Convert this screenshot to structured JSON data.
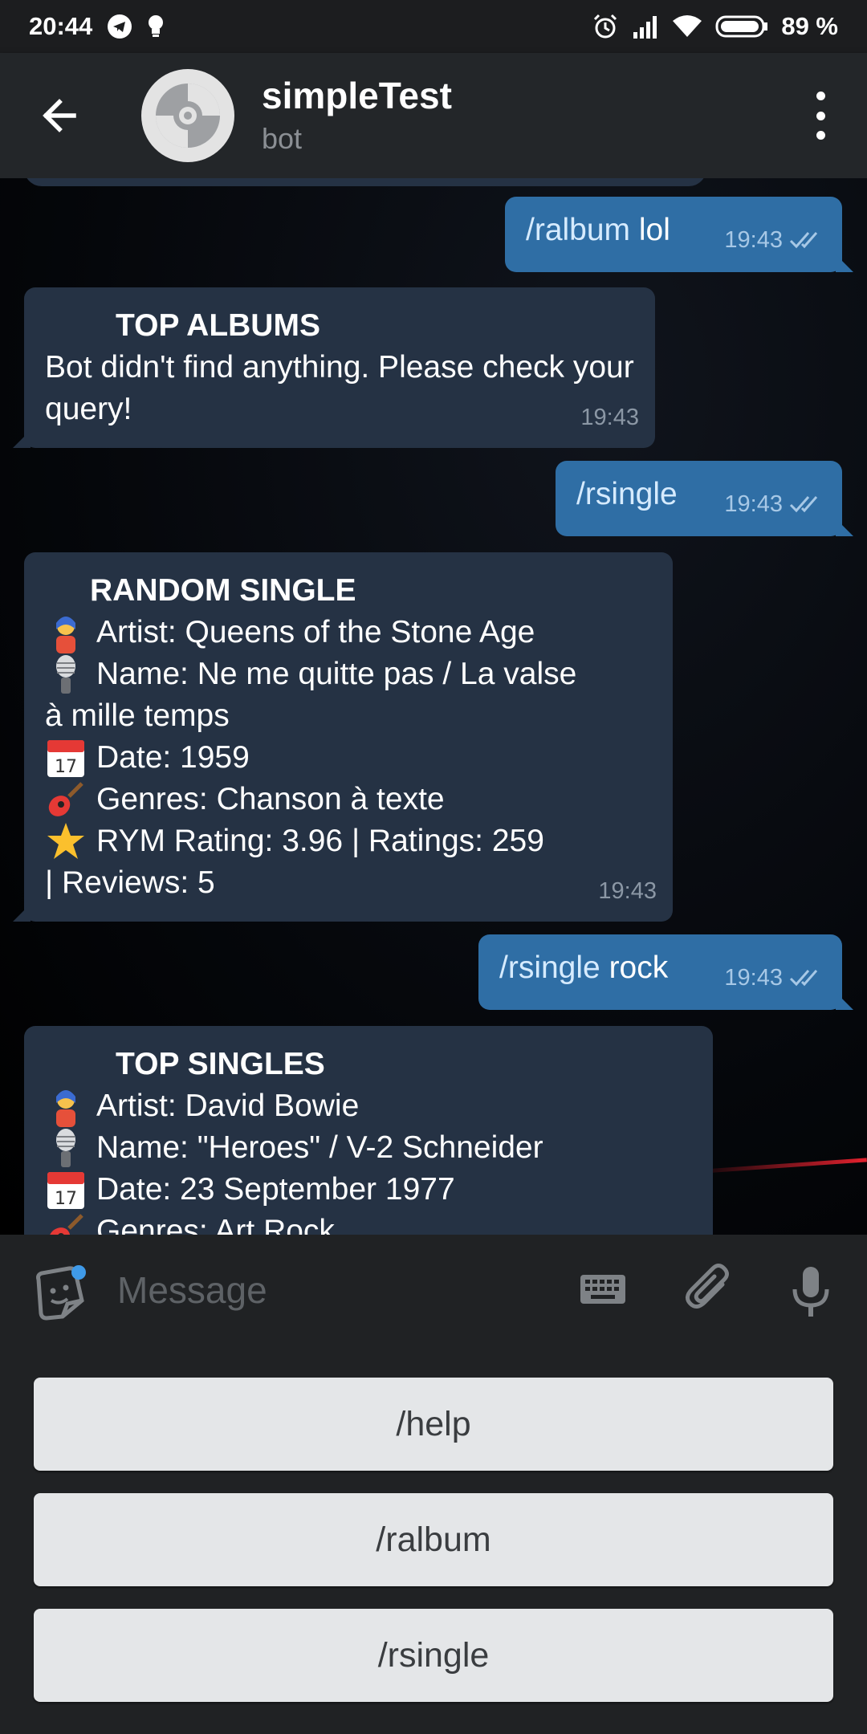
{
  "status_bar": {
    "time": "20:44",
    "battery": "89 %"
  },
  "header": {
    "title": "simpleTest",
    "subtitle": "bot"
  },
  "messages": [
    {
      "type": "out",
      "command": "/ralbum",
      "rest": " lol",
      "time": "19:43"
    },
    {
      "type": "in",
      "title": "TOP ALBUMS",
      "text": "Bot didn't find anything. Please check your query!",
      "time": "19:43"
    },
    {
      "type": "out",
      "command": "/rsingle",
      "rest": "",
      "time": "19:43"
    },
    {
      "type": "in",
      "title": "RANDOM SINGLE",
      "lines": {
        "artist": "Artist:  Queens of the Stone Age",
        "name1": "Name:  Ne me quitte pas / La valse",
        "name2": "à mille temps",
        "date": "Date:  1959",
        "genres": "Genres:  Chanson à texte",
        "rating": "RYM Rating: 3.96 | Ratings: 259",
        "reviews": "| Reviews: 5"
      },
      "time": "19:43"
    },
    {
      "type": "out",
      "command": "/rsingle",
      "rest": " rock",
      "time": "19:43"
    },
    {
      "type": "in",
      "title": "TOP SINGLES",
      "lines": {
        "artist": "Artist:  David Bowie",
        "name": "Name:  \"Heroes\" / V-2 Schneider",
        "date": "Date:  23 September 1977",
        "genres": "Genres:  Art Rock"
      }
    }
  ],
  "input": {
    "placeholder": "Message"
  },
  "keyboard": {
    "buttons": [
      "/help",
      "/ralbum",
      "/rsingle"
    ]
  },
  "icons": {
    "back": "arrow-left-icon",
    "menu": "more-vert-icon",
    "sticker": "sticker-icon",
    "keyboard": "keyboard-icon",
    "attach": "paperclip-icon",
    "mic": "microphone-icon",
    "scroll": "chevron-down-icon",
    "read": "double-check-icon"
  },
  "colors": {
    "incoming_bubble": "#253244",
    "outgoing_bubble": "#2f6ea5",
    "header": "#232629",
    "keyboard_button": "#e4e6e8"
  }
}
